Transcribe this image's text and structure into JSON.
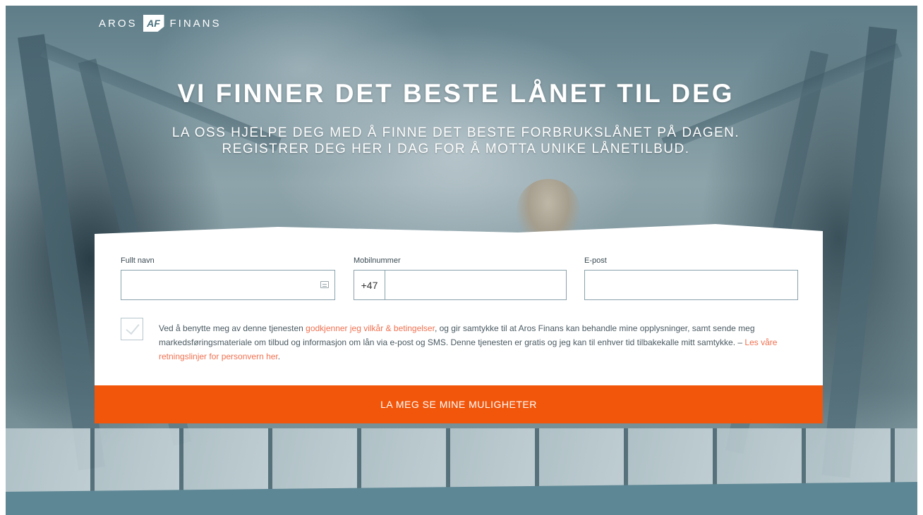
{
  "brand": {
    "name_left": "AROS",
    "logo_mark": "AF",
    "name_right": "FINANS"
  },
  "hero": {
    "headline": "VI FINNER DET BESTE LÅNET TIL DEG",
    "subhead_line1": "LA OSS HJELPE DEG MED Å FINNE DET BESTE FORBRUKSLÅNET PÅ DAGEN.",
    "subhead_line2": "REGISTRER DEG HER I DAG FOR Å MOTTA UNIKE LÅNETILBUD."
  },
  "form": {
    "name_label": "Fullt navn",
    "name_value": "",
    "phone_label": "Mobilnummer",
    "phone_prefix": "+47",
    "phone_value": "",
    "email_label": "E-post",
    "email_value": "",
    "consent": {
      "text_before": "Ved å benytte meg av denne tjenesten ",
      "terms_link": "godkjenner jeg vilkår & betingelser",
      "text_middle": ", og gir samtykke til at Aros Finans kan behandle mine opplysninger, samt sende meg markedsføringsmateriale om tilbud og informasjon om lån via e-post og SMS. Denne tjenesten er gratis og jeg kan til enhver tid tilbakekalle mitt samtykke. – ",
      "privacy_link": "Les våre retningslinjer for personvern her",
      "text_after": "."
    },
    "submit_label": "LA MEG SE MINE MULIGHETER"
  },
  "colors": {
    "accent": "#f2560b",
    "link": "#f07150",
    "band": "#5e8795"
  },
  "icons": {
    "name_field": "contact-card-icon",
    "checkbox": "checkmark-icon"
  }
}
